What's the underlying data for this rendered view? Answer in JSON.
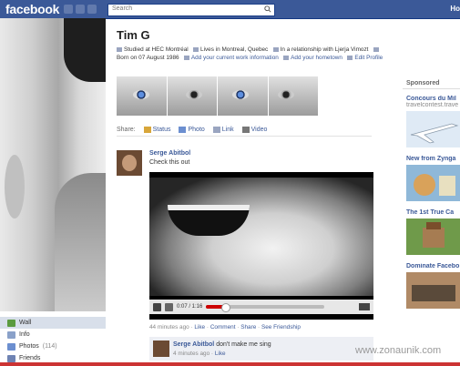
{
  "topbar": {
    "logo": "facebook",
    "search_placeholder": "Search",
    "home": "Ho"
  },
  "profile": {
    "name": "Tim G",
    "info_line1": "Studied at HEC Montréal",
    "info_line1b": "Lives in Montreal, Quebec",
    "info_line1c": "In a relationship with Ljerja Vimozt",
    "info_line2a": "Born on 07 August 1986",
    "info_line2b": "Add your current work information",
    "info_line2c": "Add your hometown",
    "edit": "Edit Profile"
  },
  "share": {
    "label": "Share:",
    "options": [
      "Status",
      "Photo",
      "Link",
      "Video"
    ]
  },
  "post": {
    "author": "Serge Abitbol",
    "message": "Check this out",
    "video_time": "0:07 / 1:16",
    "video_progress": 0.16,
    "meta_time": "44 minutes ago",
    "like": "Like",
    "comment": "Comment",
    "share": "Share",
    "see_friendship": "See Friendship"
  },
  "comment": {
    "author": "Serge Abitbol",
    "text": "don't make me sing",
    "time": "4 minutes ago",
    "like": "Like"
  },
  "sidenav": {
    "items": [
      {
        "label": "Wall",
        "count": ""
      },
      {
        "label": "Info",
        "count": ""
      },
      {
        "label": "Photos",
        "count": "(114)"
      },
      {
        "label": "Friends",
        "count": ""
      }
    ]
  },
  "sidebar": {
    "sponsored": "Sponsored",
    "ads": [
      {
        "title": "Concours du Mil",
        "url": "travelcontest.trave"
      },
      {
        "title": "New from Zynga",
        "url": ""
      },
      {
        "title": "The 1st True Ca",
        "url": ""
      },
      {
        "title": "Dominate Facebo",
        "url": ""
      }
    ]
  },
  "watermark": "www.zonaunik.com",
  "colors": {
    "brand": "#3b5998",
    "progress": "#cc0000"
  }
}
